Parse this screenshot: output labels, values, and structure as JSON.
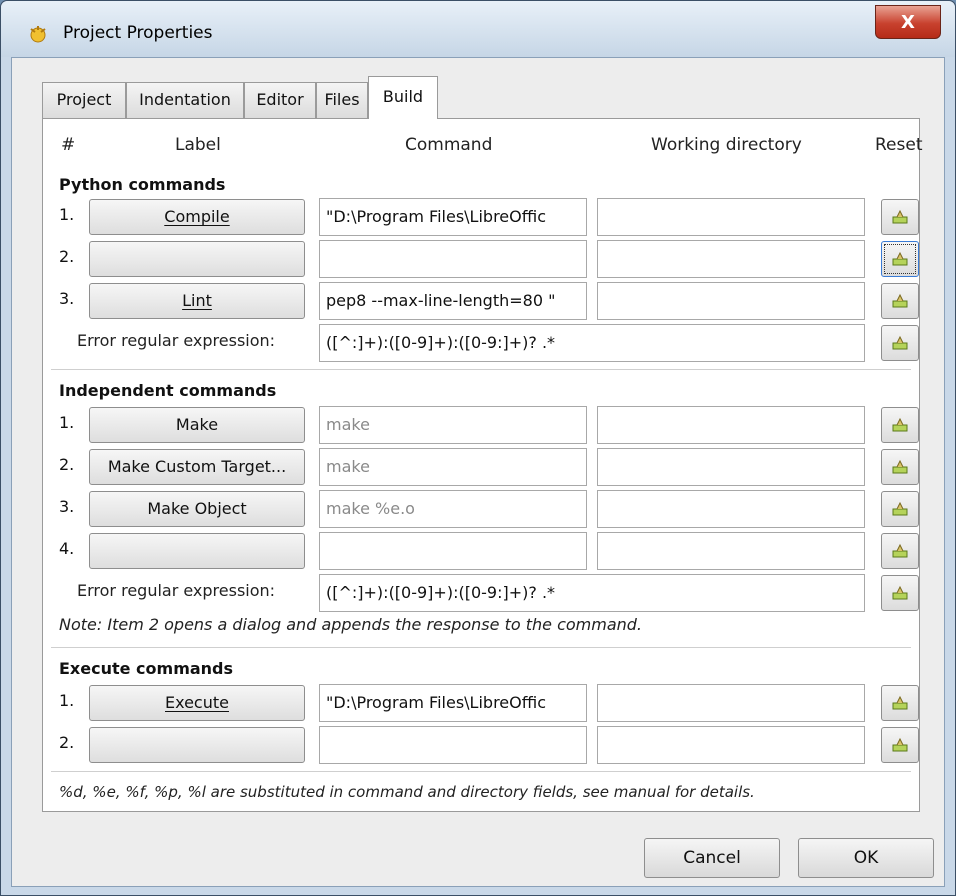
{
  "window": {
    "title": "Project Properties",
    "close_glyph": "X",
    "icon": "geany-icon"
  },
  "tabs": [
    {
      "label": "Project"
    },
    {
      "label": "Indentation"
    },
    {
      "label": "Editor"
    },
    {
      "label": "Files"
    },
    {
      "label": "Build",
      "active": true
    }
  ],
  "columns": {
    "num": "#",
    "label": "Label",
    "command": "Command",
    "working_directory": "Working directory",
    "reset": "Reset"
  },
  "python": {
    "heading": "Python commands",
    "rows": [
      {
        "num": "1.",
        "label": "Compile",
        "command": "\"D:\\Program Files\\LibreOffic",
        "workdir": ""
      },
      {
        "num": "2.",
        "label": "",
        "command": "",
        "workdir": ""
      },
      {
        "num": "3.",
        "label": "Lint",
        "command": "pep8 --max-line-length=80 \"",
        "workdir": ""
      }
    ],
    "error_label": "Error regular expression:",
    "error_value": "([^:]+):([0-9]+):([0-9:]+)? .*"
  },
  "independent": {
    "heading": "Independent commands",
    "rows": [
      {
        "num": "1.",
        "label": "Make",
        "command": "make",
        "workdir": ""
      },
      {
        "num": "2.",
        "label": "Make Custom Target...",
        "command": "make",
        "workdir": ""
      },
      {
        "num": "3.",
        "label": "Make Object",
        "command": "make %e.o",
        "workdir": ""
      },
      {
        "num": "4.",
        "label": "",
        "command": "",
        "workdir": ""
      }
    ],
    "error_label": "Error regular expression:",
    "error_value": "([^:]+):([0-9]+):([0-9:]+)? .*",
    "note": "Note: Item 2 opens a dialog and appends the response to the command."
  },
  "execute": {
    "heading": "Execute commands",
    "rows": [
      {
        "num": "1.",
        "label": "Execute",
        "command": "\"D:\\Program Files\\LibreOffic",
        "workdir": ""
      },
      {
        "num": "2.",
        "label": "",
        "command": "",
        "workdir": ""
      }
    ]
  },
  "footer_note": "%d, %e, %f, %p, %l are substituted in command and directory fields, see manual for details.",
  "buttons": {
    "cancel": "Cancel",
    "ok": "OK"
  },
  "colors": {
    "close": "#c8412e",
    "focus": "#3a7bd5"
  }
}
